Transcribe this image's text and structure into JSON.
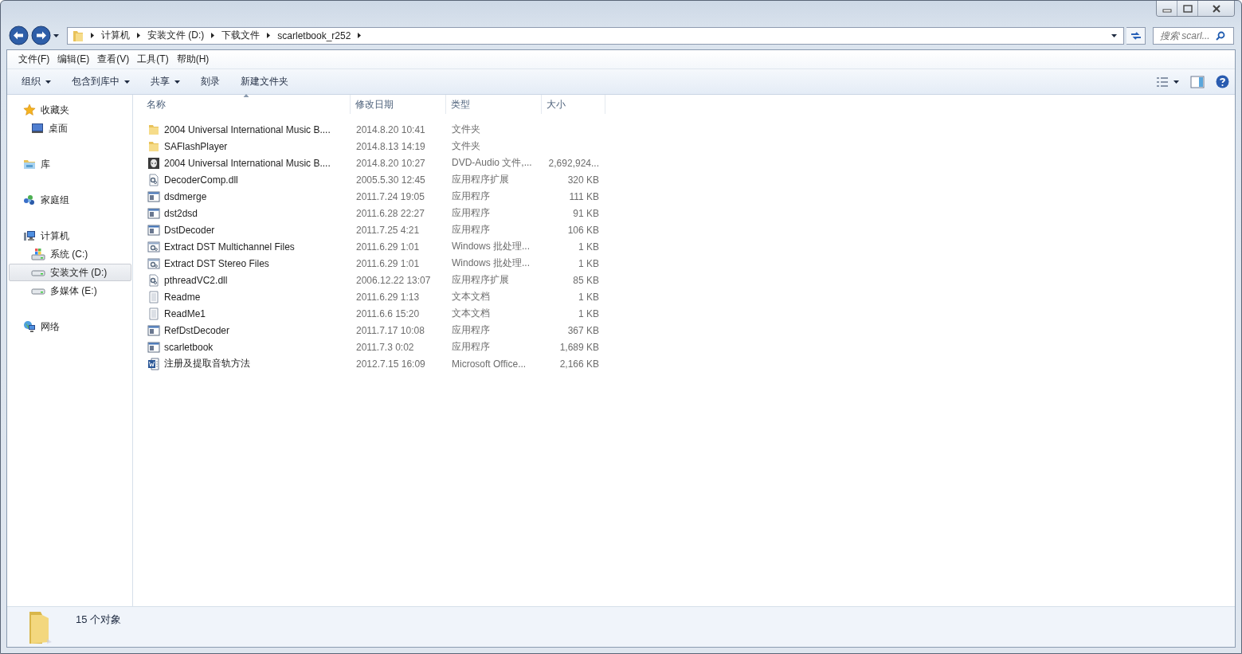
{
  "address": {
    "segments": [
      "计算机",
      "安装文件 (D:)",
      "下载文件",
      "scarletbook_r252"
    ]
  },
  "search": {
    "placeholder": "搜索 scarl..."
  },
  "menu": [
    "文件(F)",
    "编辑(E)",
    "查看(V)",
    "工具(T)",
    "帮助(H)"
  ],
  "toolbar": [
    {
      "label": "组织",
      "dropdown": true
    },
    {
      "label": "包含到库中",
      "dropdown": true
    },
    {
      "label": "共享",
      "dropdown": true
    },
    {
      "label": "刻录",
      "dropdown": false
    },
    {
      "label": "新建文件夹",
      "dropdown": false
    }
  ],
  "sidebar": [
    {
      "label": "收藏夹",
      "kind": "star",
      "selected": false,
      "children": [
        {
          "label": "桌面",
          "kind": "desktop",
          "selected": false
        }
      ]
    },
    {
      "label": "库",
      "kind": "library",
      "selected": false
    },
    {
      "label": "家庭组",
      "kind": "homegroup",
      "selected": false
    },
    {
      "label": "计算机",
      "kind": "computer",
      "selected": false,
      "children": [
        {
          "label": "系统 (C:)",
          "kind": "sysdrive",
          "selected": false
        },
        {
          "label": "安装文件 (D:)",
          "kind": "drive",
          "selected": true
        },
        {
          "label": "多媒体 (E:)",
          "kind": "drive",
          "selected": false
        }
      ]
    },
    {
      "label": "网络",
      "kind": "network",
      "selected": false
    }
  ],
  "table": {
    "columns": [
      {
        "label": "名称",
        "sorted": true
      },
      {
        "label": "修改日期",
        "sorted": false
      },
      {
        "label": "类型",
        "sorted": false
      },
      {
        "label": "大小",
        "sorted": false
      }
    ],
    "rows": [
      {
        "kind": "folder",
        "name": "2004 Universal International Music B....",
        "modified": "2014.8.20 10:41",
        "type": "文件夹",
        "size": ""
      },
      {
        "kind": "folder",
        "name": "SAFlashPlayer",
        "modified": "2014.8.13 14:19",
        "type": "文件夹",
        "size": ""
      },
      {
        "kind": "media",
        "name": "2004 Universal International Music B....",
        "modified": "2014.8.20 10:27",
        "type": "DVD-Audio 文件,...",
        "size": "2,692,924..."
      },
      {
        "kind": "dll",
        "name": "DecoderComp.dll",
        "modified": "2005.5.30 12:45",
        "type": "应用程序扩展",
        "size": "320 KB"
      },
      {
        "kind": "exe",
        "name": "dsdmerge",
        "modified": "2011.7.24 19:05",
        "type": "应用程序",
        "size": "111 KB"
      },
      {
        "kind": "exe",
        "name": "dst2dsd",
        "modified": "2011.6.28 22:27",
        "type": "应用程序",
        "size": "91 KB"
      },
      {
        "kind": "exe",
        "name": "DstDecoder",
        "modified": "2011.7.25 4:21",
        "type": "应用程序",
        "size": "106 KB"
      },
      {
        "kind": "bat",
        "name": "Extract DST Multichannel Files",
        "modified": "2011.6.29 1:01",
        "type": "Windows 批处理...",
        "size": "1 KB"
      },
      {
        "kind": "bat",
        "name": "Extract DST Stereo Files",
        "modified": "2011.6.29 1:01",
        "type": "Windows 批处理...",
        "size": "1 KB"
      },
      {
        "kind": "dll",
        "name": "pthreadVC2.dll",
        "modified": "2006.12.22 13:07",
        "type": "应用程序扩展",
        "size": "85 KB"
      },
      {
        "kind": "txt",
        "name": "Readme",
        "modified": "2011.6.29 1:13",
        "type": "文本文档",
        "size": "1 KB"
      },
      {
        "kind": "txt",
        "name": "ReadMe1",
        "modified": "2011.6.6 15:20",
        "type": "文本文档",
        "size": "1 KB"
      },
      {
        "kind": "exe",
        "name": "RefDstDecoder",
        "modified": "2011.7.17 10:08",
        "type": "应用程序",
        "size": "367 KB"
      },
      {
        "kind": "exe",
        "name": "scarletbook",
        "modified": "2011.7.3 0:02",
        "type": "应用程序",
        "size": "1,689 KB"
      },
      {
        "kind": "doc",
        "name": "注册及提取音轨方法",
        "modified": "2012.7.15 16:09",
        "type": "Microsoft Office...",
        "size": "2,166 KB"
      }
    ]
  },
  "status_bar": {
    "count": "15 个对象"
  }
}
